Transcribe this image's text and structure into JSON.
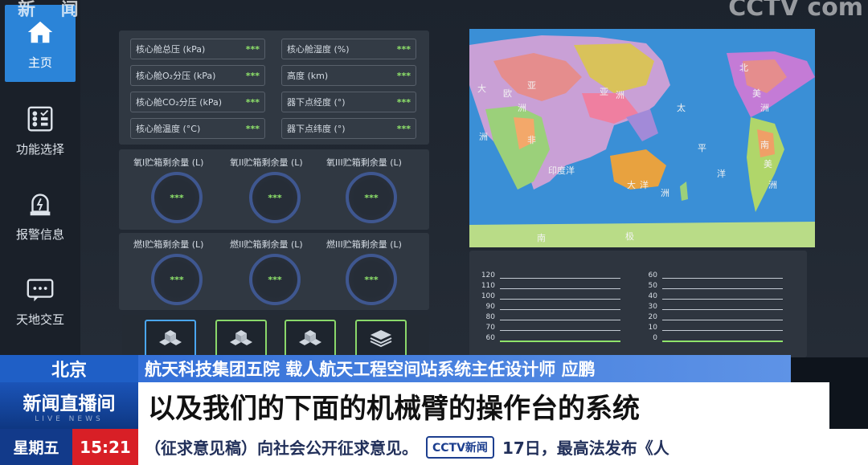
{
  "watermark": {
    "top_left": "新  闻",
    "cctv": "CCTV com"
  },
  "sidebar": {
    "items": [
      {
        "label": "主页",
        "icon": "home-icon",
        "active": true
      },
      {
        "label": "功能选择",
        "icon": "grid-checklist-icon"
      },
      {
        "label": "报警信息",
        "icon": "alarm-icon"
      },
      {
        "label": "天地交互",
        "icon": "chat-icon"
      }
    ]
  },
  "params": [
    {
      "label": "核心舱总压 (kPa)",
      "value": "***"
    },
    {
      "label": "核心舱湿度 (%)",
      "value": "***"
    },
    {
      "label": "核心舱O₂分压 (kPa)",
      "value": "***"
    },
    {
      "label": "高度 (km)",
      "value": "***"
    },
    {
      "label": "核心舱CO₂分压 (kPa)",
      "value": "***"
    },
    {
      "label": "器下点经度 (°)",
      "value": "***"
    },
    {
      "label": "核心舱温度 (°C)",
      "value": "***"
    },
    {
      "label": "器下点纬度 (°)",
      "value": "***"
    }
  ],
  "oxygen_tanks": [
    {
      "label": "氧I贮箱剩余量 (L)",
      "value": "***"
    },
    {
      "label": "氧II贮箱剩余量 (L)",
      "value": "***"
    },
    {
      "label": "氧III贮箱剩余量 (L)",
      "value": "***"
    }
  ],
  "fuel_tanks": [
    {
      "label": "燃I贮箱剩余量 (L)",
      "value": "***"
    },
    {
      "label": "燃II贮箱剩余量 (L)",
      "value": "***"
    },
    {
      "label": "燃III贮箱剩余量 (L)",
      "value": "***"
    }
  ],
  "tiles": [
    {
      "icon": "cubes-icon"
    },
    {
      "icon": "cubes-icon"
    },
    {
      "icon": "cubes-icon"
    },
    {
      "icon": "layers-icon"
    }
  ],
  "map": {
    "labels": [
      "亚",
      "欧",
      "洲",
      "非",
      "大",
      "洲",
      "亚",
      "洲",
      "太",
      "平",
      "洋",
      "印度洋",
      "大",
      "洋",
      "洲",
      "南",
      "极",
      "北",
      "美",
      "洲",
      "南",
      "美",
      "洲"
    ]
  },
  "mini_charts": [
    {
      "ticks": [
        "120",
        "110",
        "100",
        "90",
        "80",
        "70",
        "60"
      ]
    },
    {
      "ticks": [
        "60",
        "50",
        "40",
        "30",
        "20",
        "10",
        "0"
      ]
    }
  ],
  "lower_third": {
    "location": "北京",
    "speaker": "航天科技集团五院 载人航天工程空间站系统主任设计师 应鹏",
    "caption": "以及我们的下面的机械臂的操作台的系统",
    "program": "新闻直播间",
    "program_sub": "LIVE NEWS"
  },
  "ticker": {
    "day": "星期五",
    "time": "15:21",
    "text_before": "（征求意见稿）向社会公开征求意见。",
    "logo": "CCTV新闻",
    "text_after": "17日，最高法发布《人"
  }
}
